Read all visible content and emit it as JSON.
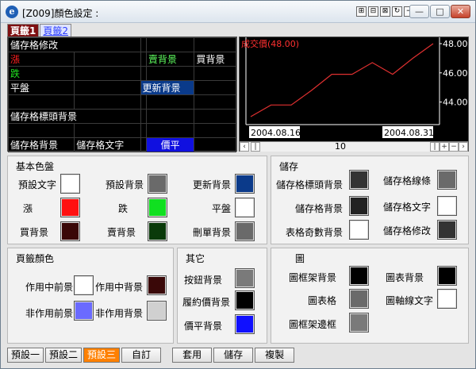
{
  "window": {
    "title": "[Z009]顏色設定 :",
    "tools": [
      "⊞",
      "⊟",
      "⊠",
      "↻",
      "−",
      "+"
    ],
    "buttons": {
      "minimize": "—",
      "restore": "□",
      "close": "✕"
    }
  },
  "tabs": [
    "頁籤1",
    "頁籤2"
  ],
  "grid": {
    "header": "儲存格修改",
    "sell_bg": "賣背景",
    "buy_bg": "買背景",
    "up": "漲",
    "down": "跌",
    "flat": "平盤",
    "update_bg": "更新背景",
    "cell_header_bg": "儲存格標頭背景",
    "cell_bg": "儲存格背景",
    "cell_text": "儲存格文字",
    "parity": "價平"
  },
  "chart": {
    "label": "成交價(48.00)",
    "y_ticks": [
      "48.00",
      "46.00",
      "44.00"
    ],
    "x_labels": [
      "2004.08.16",
      "2004.08.31"
    ],
    "scroll_value": "10",
    "series_color": "#e03030",
    "chart_data": {
      "type": "line",
      "title": "成交價(48.00)",
      "ylim": [
        43,
        48
      ],
      "x": [
        "2004.08.16",
        "",
        "",
        "",
        "",
        "",
        "",
        "",
        "",
        "2004.08.31"
      ],
      "series": [
        {
          "name": "成交價",
          "values": [
            43.0,
            43.8,
            43.8,
            44.8,
            45.9,
            45.9,
            46.7,
            45.9,
            47.0,
            48.0
          ]
        }
      ]
    }
  },
  "basic": {
    "title": "基本色盤",
    "items": [
      {
        "label": "預設文字",
        "color": "#ffffff"
      },
      {
        "label": "預設背景",
        "color": "#6a6a6a"
      },
      {
        "label": "更新背景",
        "color": "#0b3a8a"
      },
      {
        "label": "漲",
        "color": "#ff1010"
      },
      {
        "label": "跌",
        "color": "#10e020"
      },
      {
        "label": "平盤",
        "color": "#ffffff"
      },
      {
        "label": "買背景",
        "color": "#3a0808"
      },
      {
        "label": "賣背景",
        "color": "#0a3a0a"
      },
      {
        "label": "刪單背景",
        "color": "#6a6a6a"
      }
    ]
  },
  "storage": {
    "title": "儲存",
    "items": [
      {
        "label": "儲存格標頭背景",
        "color": "#333333"
      },
      {
        "label": "儲存格線條",
        "color": "#6a6a6a"
      },
      {
        "label": "儲存格背景",
        "color": "#222222"
      },
      {
        "label": "儲存格文字",
        "color": "#ffffff"
      },
      {
        "label": "表格奇數背景",
        "color": "#ffffff"
      },
      {
        "label": "儲存格修改",
        "color": "#333333"
      }
    ]
  },
  "tabcolor": {
    "title": "頁籤顏色",
    "items": [
      {
        "label": "作用中前景",
        "color": "#ffffff"
      },
      {
        "label": "作用中背景",
        "color": "#3a0808"
      },
      {
        "label": "非作用前景",
        "color": "#6a6aff"
      },
      {
        "label": "非作用背景",
        "color": "#d0d0d0"
      }
    ]
  },
  "other": {
    "title": "其它",
    "items": [
      {
        "label": "按鈕背景",
        "color": "#7a7a7a"
      },
      {
        "label": "履約價背景",
        "color": "#000000"
      },
      {
        "label": "價平背景",
        "color": "#1010ff"
      }
    ]
  },
  "graph": {
    "title": "圖",
    "items": [
      {
        "label": "圖框架背景",
        "color": "#000000"
      },
      {
        "label": "圖表背景",
        "color": "#000000"
      },
      {
        "label": "圖表格",
        "color": "#6a6a6a"
      },
      {
        "label": "圖軸線文字",
        "color": "#ffffff"
      },
      {
        "label": "圖框架邊框",
        "color": "#7a7a7a"
      }
    ]
  },
  "bottom": [
    "預設一",
    "預設二",
    "預設三",
    "自訂",
    "套用",
    "儲存",
    "複製"
  ]
}
